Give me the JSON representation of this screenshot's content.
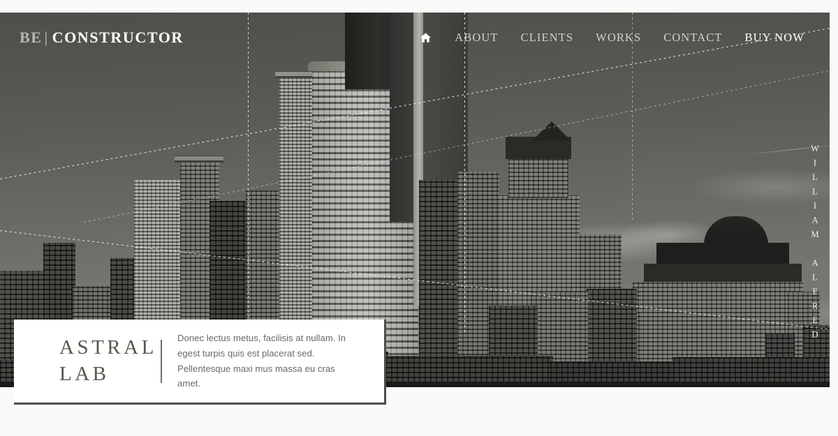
{
  "brand": {
    "prefix": "BE",
    "separator": "|",
    "name": "CONSTRUCTOR"
  },
  "nav": {
    "home_icon": "home-icon",
    "items": [
      {
        "label": "ABOUT",
        "active": false
      },
      {
        "label": "CLIENTS",
        "active": false
      },
      {
        "label": "WORKS",
        "active": false
      },
      {
        "label": "CONTACT",
        "active": false
      },
      {
        "label": "BUY NOW",
        "active": true
      }
    ]
  },
  "hero": {
    "vertical_name": "WILLIAM ALFRED",
    "image_description": "black and white city skyline with skyscrapers"
  },
  "caption_card": {
    "title": "ASTRAL\nLAB",
    "body": "Donec lectus metus, facilisis at nullam. In egest turpis quis est placerat sed. Pellentesque maxi mus massa eu cras amet."
  },
  "colors": {
    "page_background": "#fafafa",
    "card_background": "#ffffff",
    "card_border": "#4d4d48",
    "title_text": "#5a564b",
    "body_text": "#696969",
    "nav_text": "#d3d1ca",
    "nav_active_text": "#ffffff",
    "brand_prefix": "#b8b6b0",
    "brand_name": "#ffffff",
    "overlay_line": "#ffffff"
  }
}
